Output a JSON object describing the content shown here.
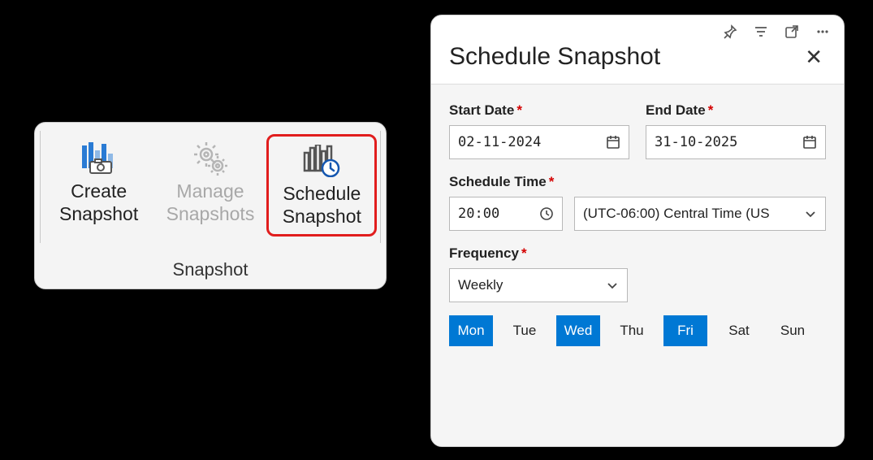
{
  "ribbon": {
    "title": "Snapshot",
    "buttons": [
      {
        "label": "Create\nSnapshot"
      },
      {
        "label": "Manage\nSnapshots"
      },
      {
        "label": "Schedule\nSnapshot"
      }
    ]
  },
  "panel": {
    "title": "Schedule Snapshot",
    "start_label": "Start Date",
    "start_value": "02-11-2024",
    "end_label": "End Date",
    "end_value": "31-10-2025",
    "time_label": "Schedule Time",
    "time_value": "20:00",
    "tz_value": "(UTC-06:00) Central Time (US",
    "freq_label": "Frequency",
    "freq_value": "Weekly",
    "days": [
      {
        "abbr": "Mon",
        "selected": true
      },
      {
        "abbr": "Tue",
        "selected": false
      },
      {
        "abbr": "Wed",
        "selected": true
      },
      {
        "abbr": "Thu",
        "selected": false
      },
      {
        "abbr": "Fri",
        "selected": true
      },
      {
        "abbr": "Sat",
        "selected": false
      },
      {
        "abbr": "Sun",
        "selected": false
      }
    ]
  }
}
